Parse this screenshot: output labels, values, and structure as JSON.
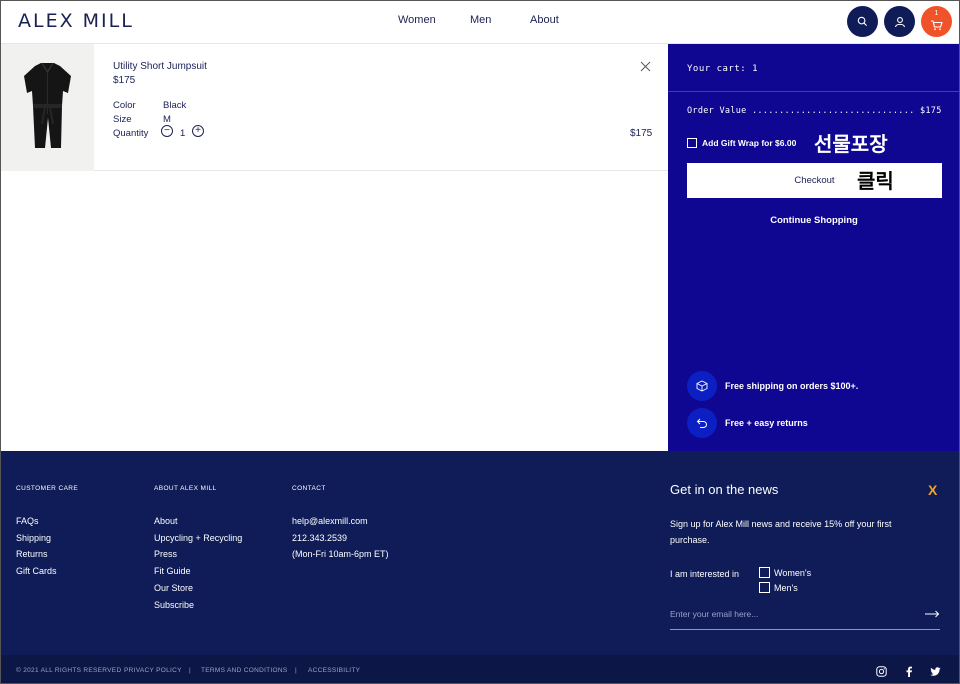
{
  "header": {
    "logo": "ALEX MILL",
    "nav": {
      "women": "Women",
      "men": "Men",
      "about": "About"
    },
    "cart_count": "1"
  },
  "cart_item": {
    "name": "Utility Short Jumpsuit",
    "price": "$175",
    "color_label": "Color",
    "color_value": "Black",
    "size_label": "Size",
    "size_value": "M",
    "quantity_label": "Quantity",
    "quantity_value": "1",
    "line_total": "$175"
  },
  "panel": {
    "title": "Your cart: 1",
    "order_value": "Order Value .............................. $175",
    "gift_wrap": "Add Gift Wrap for $6.00",
    "checkout": "Checkout",
    "continue": "Continue Shopping",
    "perk_shipping": "Free shipping on orders $100+.",
    "perk_returns": "Free + easy returns",
    "annotation_gift": "선물포장",
    "annotation_click": "클릭"
  },
  "footer": {
    "customer_care": {
      "title": "CUSTOMER CARE",
      "links": [
        "FAQs",
        "Shipping",
        "Returns",
        "Gift Cards"
      ]
    },
    "about": {
      "title": "ABOUT ALEX MILL",
      "links": [
        "About",
        "Upcycling + Recycling",
        "Press",
        "Fit Guide",
        "Our Store",
        "Subscribe"
      ]
    },
    "contact": {
      "title": "CONTACT",
      "lines": [
        "help@alexmill.com",
        "212.343.2539",
        "(Mon-Fri 10am-6pm ET)"
      ]
    },
    "newsletter": {
      "title": "Get in on the news",
      "description": "Sign up for Alex Mill news and receive 15% off your first purchase.",
      "interest_label": "I am interested in",
      "option_women": "Women's",
      "option_men": "Men's",
      "email_placeholder": "Enter your email here...",
      "brand_mark": "X"
    }
  },
  "bottom": {
    "copyright": "© 2021 ALL RIGHTS RESERVED",
    "privacy": "PRIVACY POLICY",
    "sep1": "|",
    "terms": "TERMS AND CONDITIONS",
    "sep2": "|",
    "accessibility": "ACCESSIBILITY"
  },
  "colors": {
    "panel": "#0f0691",
    "footer": "#0f1c57",
    "cart_button": "#f0522a"
  }
}
